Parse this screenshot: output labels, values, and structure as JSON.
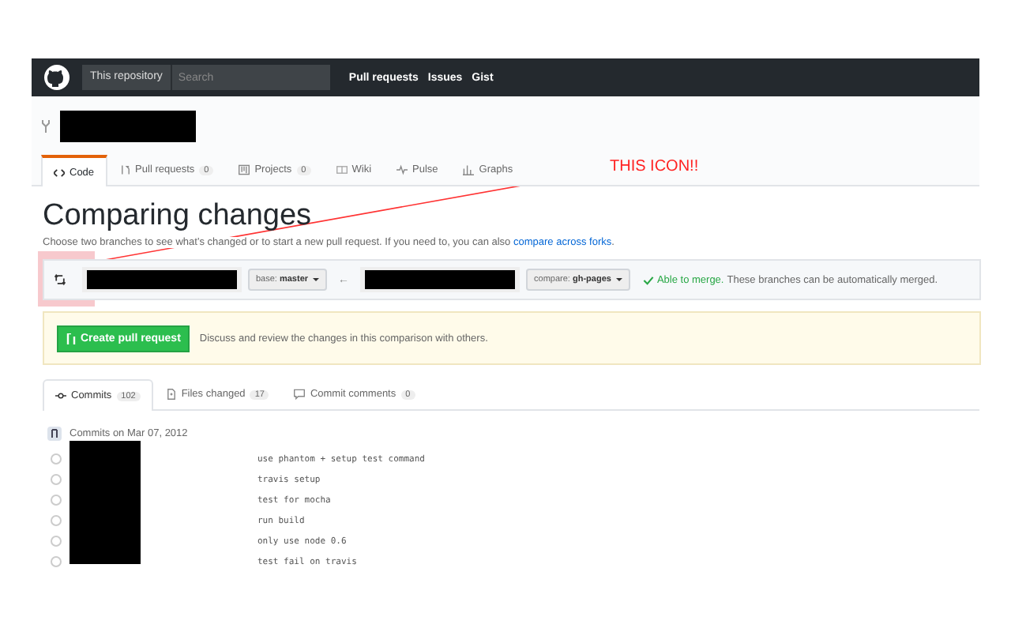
{
  "header": {
    "scope": "This repository",
    "search": {
      "placeholder": "Search"
    },
    "nav": [
      "Pull requests",
      "Issues",
      "Gist"
    ]
  },
  "repo_tabs": [
    {
      "label": "Code",
      "selected": true
    },
    {
      "label": "Pull requests",
      "count": "0",
      "selected": false
    },
    {
      "label": "Projects",
      "count": "0",
      "selected": false
    },
    {
      "label": "Wiki",
      "selected": false
    },
    {
      "label": "Pulse",
      "selected": false
    },
    {
      "label": "Graphs",
      "selected": false
    }
  ],
  "annotation": {
    "text": "THIS ICON!!"
  },
  "page_title": "Comparing changes",
  "intro": {
    "text": "Choose two branches to see what’s changed or to start a new pull request. If you need to, you can also ",
    "link": "compare across forks",
    "end": "."
  },
  "range": {
    "base": {
      "prefix": "base:",
      "branch": "master"
    },
    "separator": "←",
    "compare": {
      "prefix": "compare:",
      "branch": "gh-pages"
    },
    "merge_status": "Able to merge.",
    "merge_message": "These branches can be automatically merged."
  },
  "pull_request": {
    "button": "Create pull request",
    "hint": "Discuss and review the changes in this comparison with others."
  },
  "compare_tabs": [
    {
      "label": "Commits",
      "count": "102",
      "selected": true
    },
    {
      "label": "Files changed",
      "count": "17",
      "selected": false
    },
    {
      "label": "Commit comments",
      "count": "0",
      "selected": false
    }
  ],
  "commit_group": {
    "date": "Commits on Mar 07, 2012",
    "commits": [
      "use phantom + setup test command",
      "travis setup",
      "test for mocha",
      "run build",
      "only use node 0.6",
      "test fail on travis"
    ]
  }
}
